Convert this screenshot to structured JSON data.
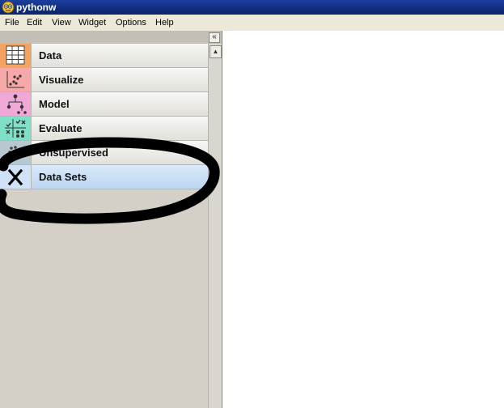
{
  "window": {
    "title": "pythonw"
  },
  "menu": [
    "File",
    "Edit",
    "View",
    "Widget",
    "Options",
    "Help"
  ],
  "sidebar": {
    "collapse_glyph": "«",
    "categories": [
      {
        "label": "Data",
        "icon": "table-icon",
        "color": "#f4a460"
      },
      {
        "label": "Visualize",
        "icon": "scatter-plot-icon",
        "color": "#f7a8a8"
      },
      {
        "label": "Model",
        "icon": "tree-icon",
        "color": "#f0a8d8"
      },
      {
        "label": "Evaluate",
        "icon": "evaluate-grid-icon",
        "color": "#7fe0c8"
      },
      {
        "label": "Unsupervised",
        "icon": "cluster-icon",
        "color": "#b8c8d0"
      },
      {
        "label": "Data Sets",
        "icon": "x-icon",
        "color": "#cfe2f7"
      }
    ]
  },
  "colors": {
    "titlebar": "#0a246a",
    "selected_row": "#cfe2f7",
    "annotation_stroke": "#000000"
  }
}
